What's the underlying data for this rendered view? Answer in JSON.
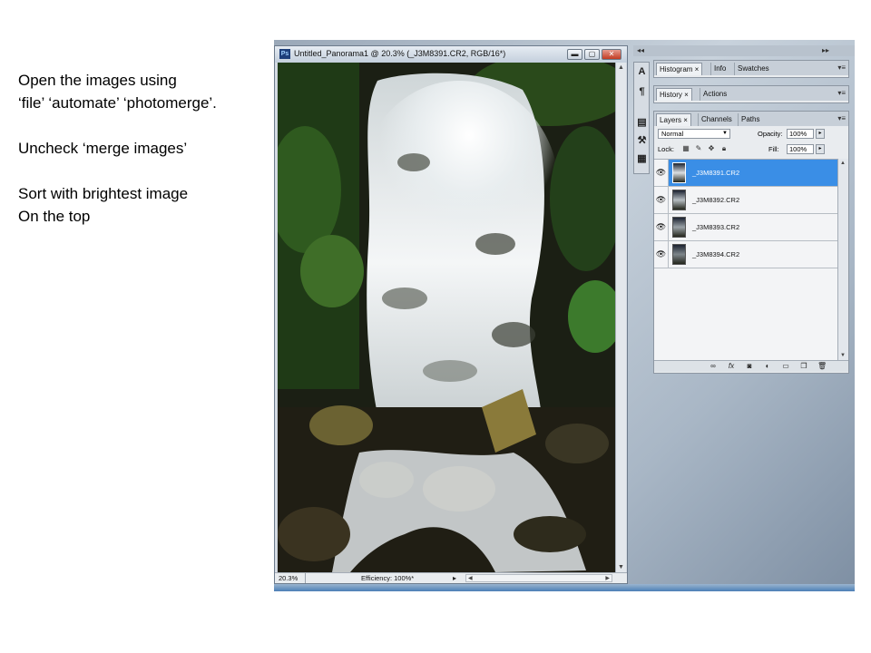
{
  "instructions": {
    "line1": "Open the images using",
    "line2": "‘file’ ‘automate’ ‘photomerge’.",
    "line3": "Uncheck ‘merge images’",
    "line4": "Sort with brightest image",
    "line5": "On the top"
  },
  "document_window": {
    "title": "Untitled_Panorama1 @ 20.3% (_J3M8391.CR2, RGB/16*)",
    "app_icon": "Ps",
    "minimize_glyph": "▬",
    "maximize_glyph": "▢",
    "close_glyph": "✕",
    "zoom": "20.3%",
    "efficiency": "Efficiency: 100%*",
    "status_arrow": "▸"
  },
  "panel_dock": {
    "collapse_glyph": "◂◂",
    "expand_glyph": "▸▸"
  },
  "panels": {
    "group1": {
      "tabs": [
        "Histogram ×",
        "Info",
        "Swatches"
      ]
    },
    "group2": {
      "tabs": [
        "History ×",
        "Actions"
      ]
    },
    "group3": {
      "tabs": [
        "Layers ×",
        "Channels",
        "Paths"
      ]
    }
  },
  "layers_panel": {
    "blend_mode": "Normal",
    "opacity_label": "Opacity:",
    "opacity_value": "100%",
    "lock_label": "Lock:",
    "fill_label": "Fill:",
    "fill_value": "100%",
    "layers": [
      {
        "name": "_J3M8391.CR2",
        "selected": true
      },
      {
        "name": "_J3M8392.CR2",
        "selected": false
      },
      {
        "name": "_J3M8393.CR2",
        "selected": false
      },
      {
        "name": "_J3M8394.CR2",
        "selected": false
      }
    ],
    "footer_icons": [
      "link-icon",
      "fx-icon",
      "mask-icon",
      "adjustment-icon",
      "group-icon",
      "new-layer-icon",
      "trash-icon"
    ]
  },
  "colors": {
    "selection": "#3a8ee6",
    "window_border": "#6d7b8c"
  }
}
